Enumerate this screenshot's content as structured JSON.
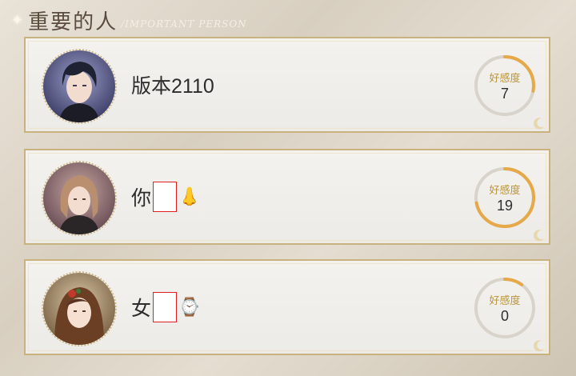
{
  "header": {
    "title": "重要的人",
    "subtitle": "IMPORTANT PERSON"
  },
  "persons": [
    {
      "name": "版本2110",
      "emoji": "",
      "affinity_label": "好感度",
      "affinity": "7",
      "affinity_fill": 0.28
    },
    {
      "name": "你",
      "emoji": "👃",
      "affinity_label": "好感度",
      "affinity": "19",
      "affinity_fill": 0.72
    },
    {
      "name": "女",
      "emoji": "⌚",
      "affinity_label": "好感度",
      "affinity": "0",
      "affinity_fill": 0.1
    }
  ],
  "colors": {
    "frame": "#c9b27e",
    "gauge_track": "#d8d4cc",
    "gauge_fill": "#e6a94a"
  }
}
